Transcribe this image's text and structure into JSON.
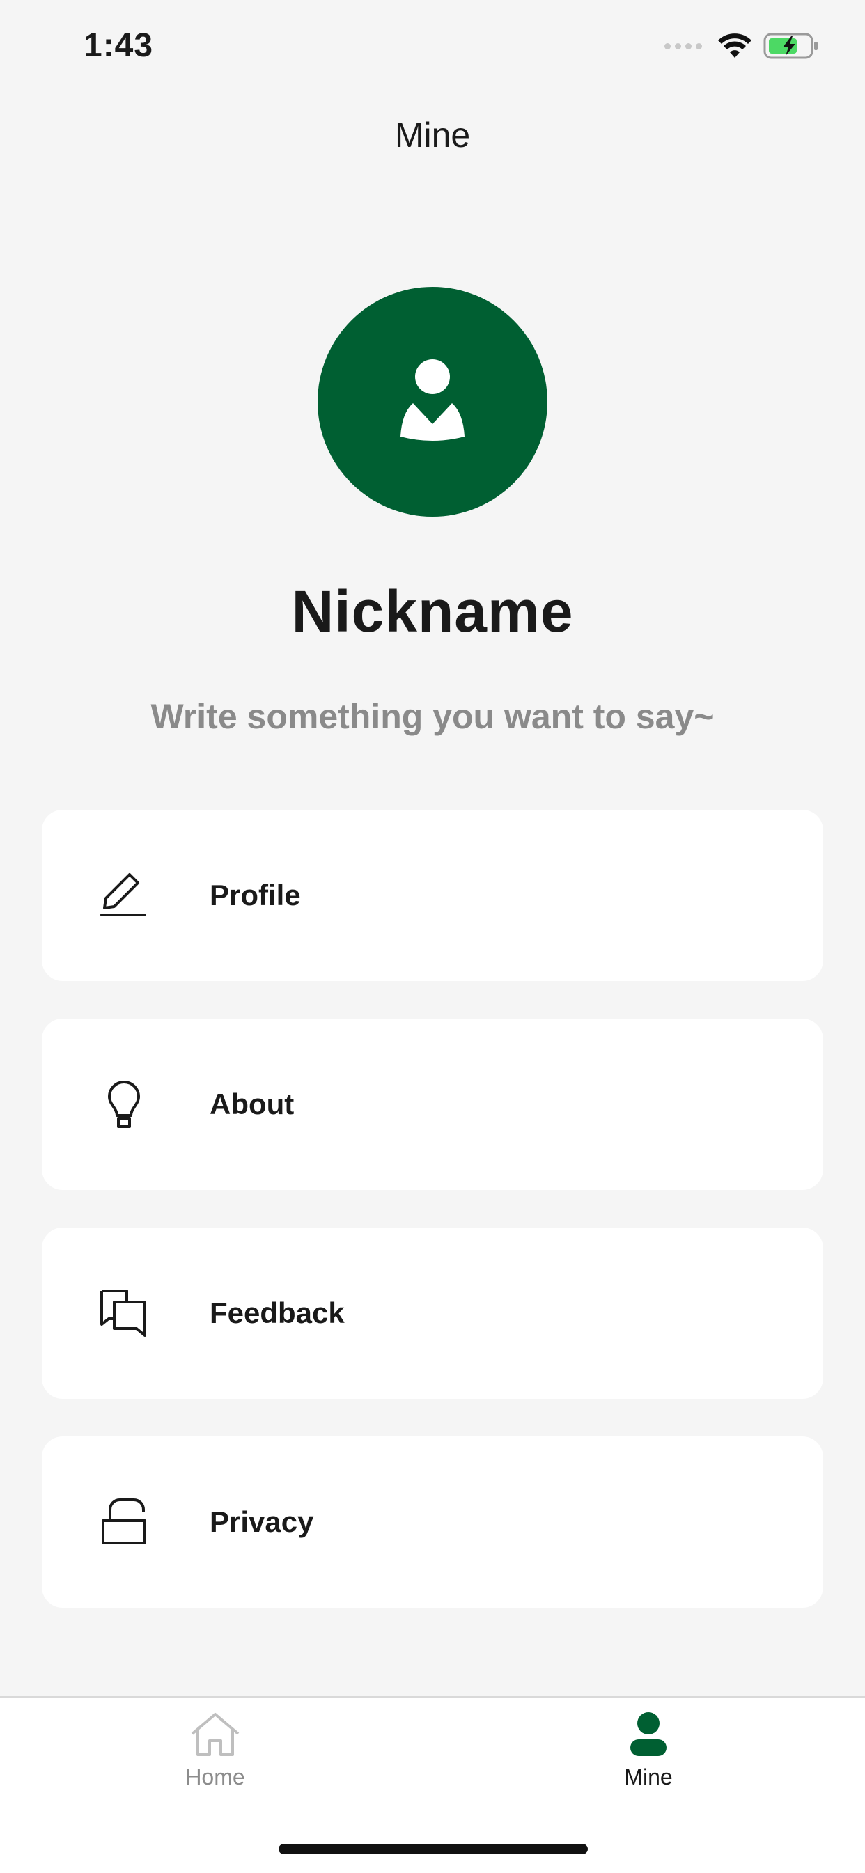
{
  "status_bar": {
    "time": "1:43",
    "icons": [
      "signal-dots-icon",
      "wifi-icon",
      "battery-charging-icon"
    ],
    "battery_color": "#4cd964"
  },
  "header": {
    "title": "Mine"
  },
  "profile": {
    "avatar_icon": "user-avatar-icon",
    "avatar_color": "#005f32",
    "nickname": "Nickname",
    "bio": "Write something you want to say~"
  },
  "menu": {
    "items": [
      {
        "label": "Profile",
        "icon": "pencil-edit-icon"
      },
      {
        "label": "About",
        "icon": "lightbulb-icon"
      },
      {
        "label": "Feedback",
        "icon": "chat-bubbles-icon"
      },
      {
        "label": "Privacy",
        "icon": "unlocked-padlock-icon"
      }
    ]
  },
  "tab_bar": {
    "tabs": [
      {
        "label": "Home",
        "icon": "home-icon",
        "active": false
      },
      {
        "label": "Mine",
        "icon": "person-icon",
        "active": true
      }
    ],
    "active_color": "#005f32",
    "inactive_color": "#bfbfbf"
  }
}
